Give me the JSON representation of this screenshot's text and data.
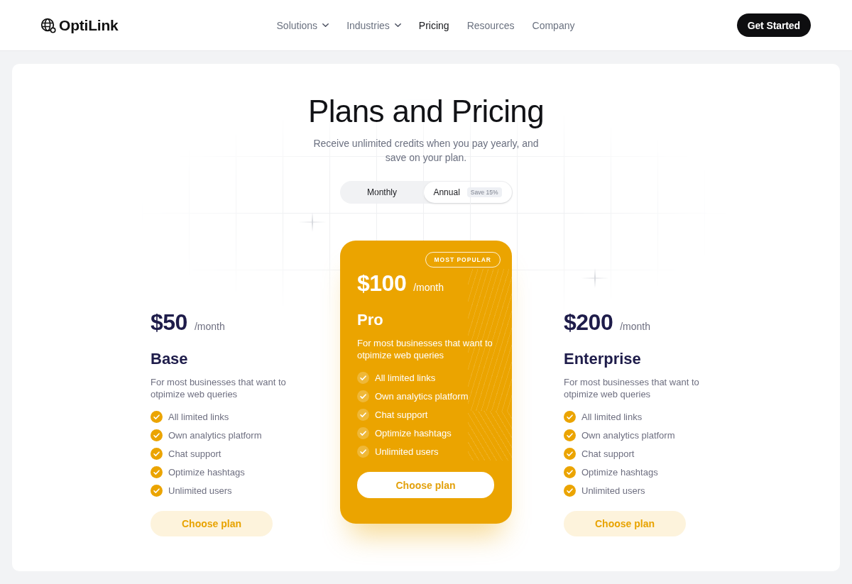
{
  "header": {
    "logo": "OptiLink",
    "nav": [
      {
        "label": "Solutions",
        "dropdown": true,
        "selected": false
      },
      {
        "label": "Industries",
        "dropdown": true,
        "selected": false
      },
      {
        "label": "Pricing",
        "dropdown": false,
        "selected": true
      },
      {
        "label": "Resources",
        "dropdown": false,
        "selected": false
      },
      {
        "label": "Company",
        "dropdown": false,
        "selected": false
      }
    ],
    "cta": "Get Started"
  },
  "hero": {
    "title": "Plans and Pricing",
    "subtitle": "Receive unlimited credits when you pay yearly, and save on your plan."
  },
  "billing_toggle": [
    {
      "label": "Monthly",
      "selected": false
    },
    {
      "label": "Annual",
      "selected": true,
      "badge": "Save 15%"
    }
  ],
  "plans": [
    {
      "price": "$50",
      "period": "/month",
      "name": "Base",
      "description": "For most businesses that want to otpimize web queries",
      "features": [
        "All limited links",
        "Own analytics platform",
        "Chat support",
        "Optimize hashtags",
        "Unlimited users"
      ],
      "button": "Choose plan",
      "featured": false
    },
    {
      "badge": "MOST POPULAR",
      "price": "$100",
      "period": "/month",
      "name": "Pro",
      "description": "For most businesses that want to otpimize web queries",
      "features": [
        "All limited links",
        "Own analytics platform",
        "Chat support",
        "Optimize hashtags",
        "Unlimited users"
      ],
      "button": "Choose plan",
      "featured": true
    },
    {
      "price": "$200",
      "period": "/month",
      "name": "Enterprise",
      "description": "For most businesses that want to otpimize web queries",
      "features": [
        "All limited links",
        "Own analytics platform",
        "Chat support",
        "Optimize hashtags",
        "Unlimited users"
      ],
      "button": "Choose plan",
      "featured": false
    }
  ]
}
